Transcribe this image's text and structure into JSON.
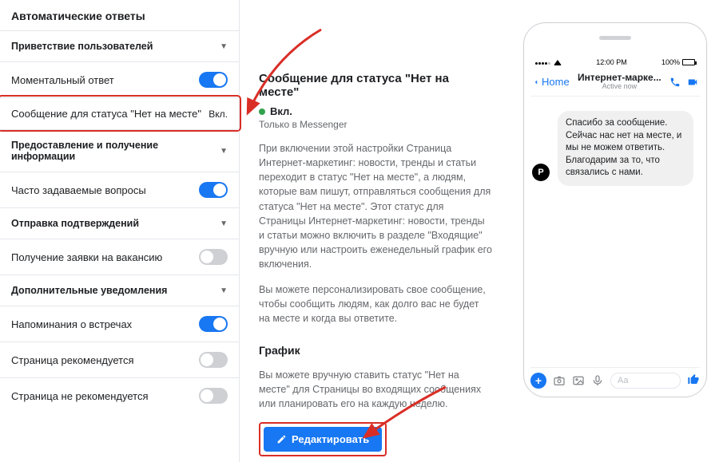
{
  "sidebar": {
    "title": "Автоматические ответы",
    "sections": [
      {
        "header": "Приветствие пользователей",
        "rows": [
          {
            "label": "Моментальный ответ",
            "toggle_on": true
          },
          {
            "label": "Сообщение для статуса \"Нет на месте\"",
            "status": "Вкл.",
            "selected": true
          }
        ]
      },
      {
        "header": "Предоставление и получение информации",
        "rows": [
          {
            "label": "Часто задаваемые вопросы",
            "toggle_on": true
          }
        ]
      },
      {
        "header": "Отправка подтверждений",
        "rows": [
          {
            "label": "Получение заявки на вакансию",
            "toggle_on": false
          }
        ]
      },
      {
        "header": "Дополнительные уведомления",
        "rows": [
          {
            "label": "Напоминания о встречах",
            "toggle_on": true
          },
          {
            "label": "Страница рекомендуется",
            "toggle_on": false
          },
          {
            "label": "Страница не рекомендуется",
            "toggle_on": false
          }
        ]
      }
    ]
  },
  "content": {
    "heading": "Сообщение для статуса \"Нет на месте\"",
    "status_label": "Вкл.",
    "status_color": "#31a24c",
    "channel_note": "Только в Messenger",
    "paragraph1": "При включении этой настройки Страница Интернет-маркетинг: новости, тренды и статьи переходит в статус \"Нет на месте\", а людям, которые вам пишут, отправляться сообщения для статуса \"Нет на месте\". Этот статус для Страницы Интернет-маркетинг: новости, тренды и статьи можно включить в разделе \"Входящие\" вручную или настроить еженедельный график его включения.",
    "paragraph2": "Вы можете персонализировать свое сообщение, чтобы сообщить людям, как долго вас не будет на месте и когда вы ответите.",
    "schedule_heading": "График",
    "paragraph3": "Вы можете вручную ставить статус \"Нет на месте\" для Страницы во входящих сообщениях или планировать его на каждую неделю.",
    "edit_button": "Редактировать"
  },
  "phone": {
    "statusbar": {
      "time": "12:00 PM",
      "battery": "100%"
    },
    "header": {
      "back": "Home",
      "title": "Интернет-марке...",
      "subtitle": "Active now"
    },
    "avatar_letter": "P",
    "message": "Спасибо за сообщение. Сейчас нас нет на месте, и мы не можем ответить. Благодарим за то, что связались с нами.",
    "composer_placeholder": "Aa"
  },
  "colors": {
    "accent": "#1877f2",
    "annotation": "#d92e26"
  }
}
